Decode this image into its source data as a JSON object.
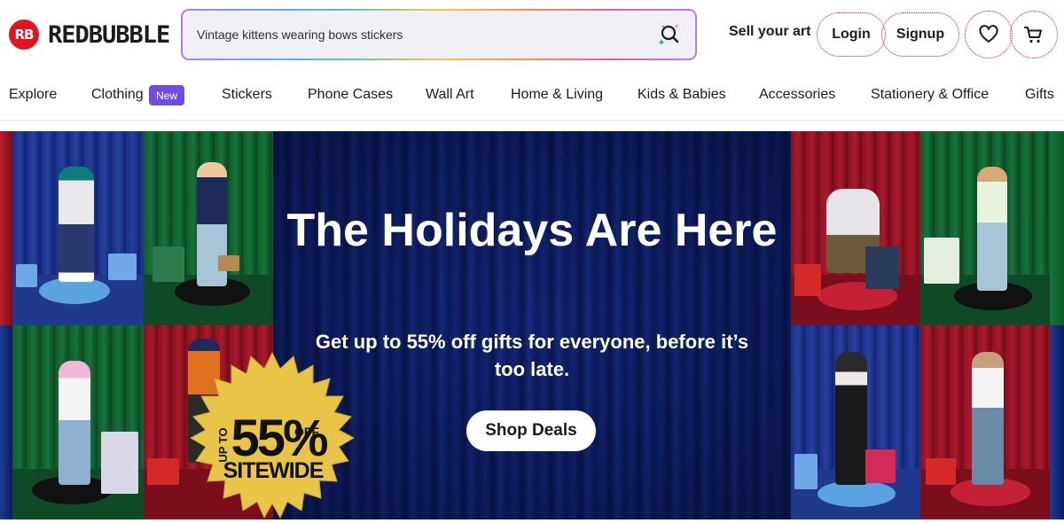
{
  "header": {
    "logo_mark": "RB",
    "logo_text": "REDBUBBLE",
    "search_value": "Vintage kittens wearing bows stickers",
    "sell_link": "Sell your art",
    "login_label": "Login",
    "signup_label": "Signup",
    "wishlist_icon": "heart-icon",
    "cart_icon": "cart-icon"
  },
  "nav": {
    "items": [
      {
        "label": "Explore"
      },
      {
        "label": "Clothing"
      },
      {
        "label": "Stickers"
      },
      {
        "label": "Phone Cases"
      },
      {
        "label": "Wall Art"
      },
      {
        "label": "Home & Living"
      },
      {
        "label": "Kids & Babies"
      },
      {
        "label": "Accessories"
      },
      {
        "label": "Stationery & Office"
      },
      {
        "label": "Gifts"
      }
    ],
    "new_badge": "New"
  },
  "hero": {
    "headline": "The Holidays Are Here",
    "subline": "Get up to 55% off gifts for everyone, before it’s too late.",
    "cta_label": "Shop Deals",
    "badge": {
      "up_to": "UP TO",
      "percent": "55%",
      "off": "OFF",
      "sitewide": "SITEWIDE"
    }
  },
  "colors": {
    "brand": "#e41321",
    "badge_purple": "#6f4de0",
    "hero_blue": "#0c1c5e",
    "gold": "#e8c547"
  }
}
